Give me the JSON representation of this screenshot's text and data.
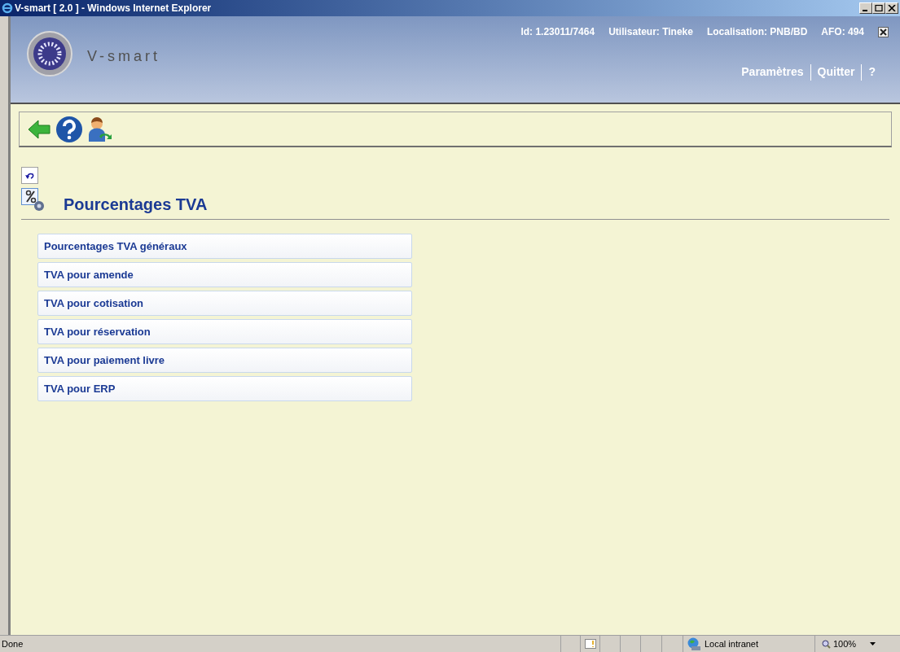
{
  "window": {
    "title": "V-smart [ 2.0 ] - Windows Internet Explorer"
  },
  "header": {
    "logo_text": "V-smart",
    "info": [
      "Id: 1.23011/7464",
      "Utilisateur: Tineke",
      "Localisation: PNB/BD",
      "AFO: 494"
    ],
    "links": [
      "Paramètres",
      "Quitter",
      "?"
    ]
  },
  "page": {
    "title": "Pourcentages TVA"
  },
  "menu": [
    "Pourcentages TVA généraux",
    "TVA pour amende",
    "TVA pour cotisation",
    "TVA pour réservation",
    "TVA pour paiement livre",
    "TVA pour ERP"
  ],
  "status_bar": {
    "text": "Done",
    "zone": "Local intranet",
    "zoom": "100%"
  }
}
